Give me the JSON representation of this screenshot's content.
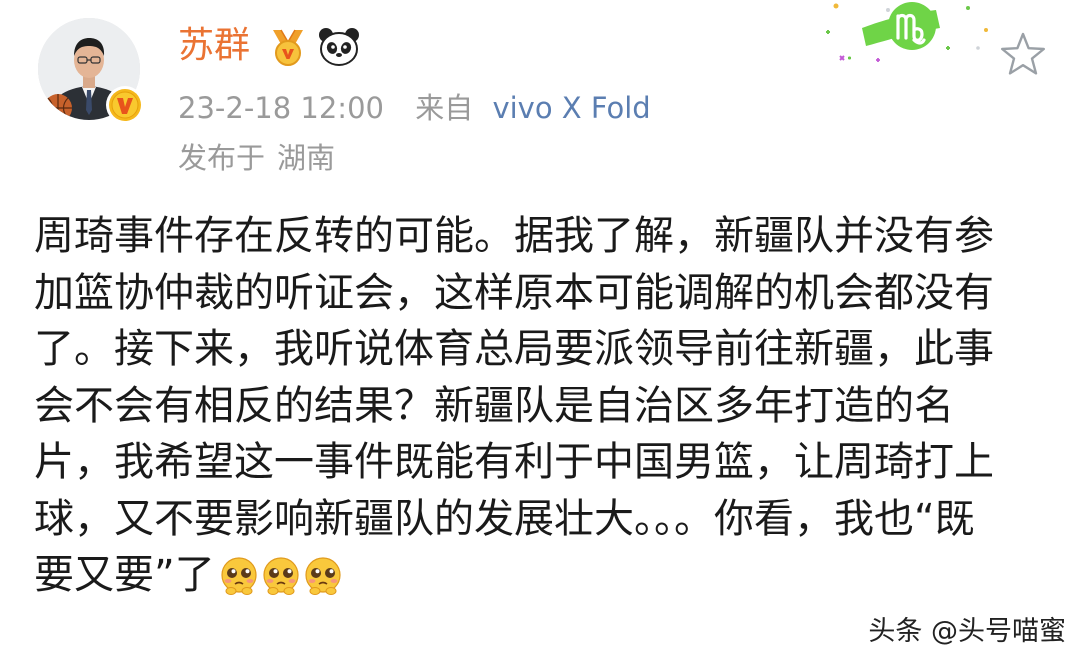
{
  "post": {
    "author": {
      "name": "苏群",
      "name_color": "#ea7333",
      "verified": true,
      "badges": [
        "medal-icon",
        "panda-icon"
      ]
    },
    "meta": {
      "time": "23-2-18 12:00",
      "from_label": "来自",
      "device": "vivo X Fold",
      "location_label": "发布于",
      "location": "湖南"
    },
    "body_lines": [
      "周琦事件存在反转的可能。据我了解，新疆队并没有参",
      "加篮协仲裁的听证会，这样原本可能调解的机会都没有",
      "了。接下来，我听说体育总局要派领导前往新疆，此事",
      "会不会有相反的结果？新疆队是自治区多年打造的名",
      "片，我希望这一事件既能有利于中国男篮，让周琦打上",
      "球，又不要影响新疆队的发展壮大。。。你看，我也“既",
      "要又要”了"
    ],
    "trailing_emojis": [
      "pleading-face-emoji",
      "pleading-face-emoji",
      "pleading-face-emoji"
    ]
  },
  "decoration": {
    "zodiac_card": "virgo-icon",
    "star_button": "star-outline-icon"
  },
  "watermark": {
    "text": "头条 @头号喵蜜"
  },
  "colors": {
    "accent_orange": "#ea7333",
    "link_blue": "#5b7eb1",
    "meta_gray": "#9a9a9a",
    "body_text": "#1a1a1a",
    "virgo_green": "#6fd447"
  }
}
